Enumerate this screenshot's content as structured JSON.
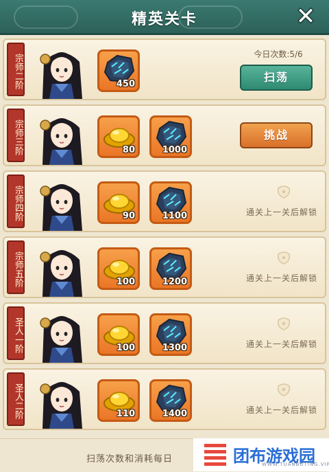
{
  "header": {
    "title": "精英关卡",
    "close_label": "✕"
  },
  "daily": {
    "label": "今日次数:5/6"
  },
  "locked_text": "通关上一关后解锁",
  "rows": [
    {
      "tag": "宗师二阶",
      "items": [
        {
          "icon": "crystal-icon",
          "count": "450"
        }
      ],
      "action": "sweep",
      "button_label": "扫荡"
    },
    {
      "tag": "宗师三阶",
      "items": [
        {
          "icon": "gold-ingot-icon",
          "count": "80"
        },
        {
          "icon": "crystal-icon",
          "count": "1000"
        }
      ],
      "action": "challenge",
      "button_label": "挑战"
    },
    {
      "tag": "宗师四阶",
      "items": [
        {
          "icon": "gold-ingot-icon",
          "count": "90"
        },
        {
          "icon": "crystal-icon",
          "count": "1100"
        }
      ],
      "action": "locked"
    },
    {
      "tag": "宗师五阶",
      "items": [
        {
          "icon": "gold-ingot-icon",
          "count": "100"
        },
        {
          "icon": "crystal-icon",
          "count": "1200"
        }
      ],
      "action": "locked"
    },
    {
      "tag": "圣人一阶",
      "items": [
        {
          "icon": "gold-ingot-icon",
          "count": "100"
        },
        {
          "icon": "crystal-icon",
          "count": "1300"
        }
      ],
      "action": "locked"
    },
    {
      "tag": "圣人二阶",
      "items": [
        {
          "icon": "gold-ingot-icon",
          "count": "110"
        },
        {
          "icon": "crystal-icon",
          "count": "1400"
        }
      ],
      "action": "locked"
    }
  ],
  "footer": {
    "text": "扫荡次数和消耗每日"
  },
  "watermark": {
    "text": "团布游戏园",
    "sub": "WWW.TUANBUTING.VIP"
  },
  "colors": {
    "sweep": "#2f8a72",
    "challenge": "#d9702a",
    "item_bg": "#ea7626",
    "tag": "#b3362a"
  }
}
